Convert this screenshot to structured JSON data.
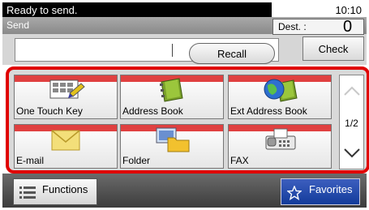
{
  "status": {
    "message": "Ready to send.",
    "time": "10:10"
  },
  "title": "Send",
  "destination": {
    "label": "Dest. :",
    "count": "0"
  },
  "recall_label": "Recall",
  "check_label": "Check",
  "destinations": [
    {
      "label": "One Touch Key",
      "icon": "one-touch-key-icon"
    },
    {
      "label": "Address Book",
      "icon": "address-book-icon"
    },
    {
      "label": "Ext Address Book",
      "icon": "ext-address-book-icon"
    },
    {
      "label": "E-mail",
      "icon": "email-icon"
    },
    {
      "label": "Folder",
      "icon": "folder-icon"
    },
    {
      "label": "FAX",
      "icon": "fax-icon"
    }
  ],
  "pager": {
    "page": "1/2"
  },
  "functions_label": "Functions",
  "favorites_label": "Favorites",
  "colors": {
    "accent_red": "#e00000",
    "favorites_blue": "#1e44a8"
  }
}
